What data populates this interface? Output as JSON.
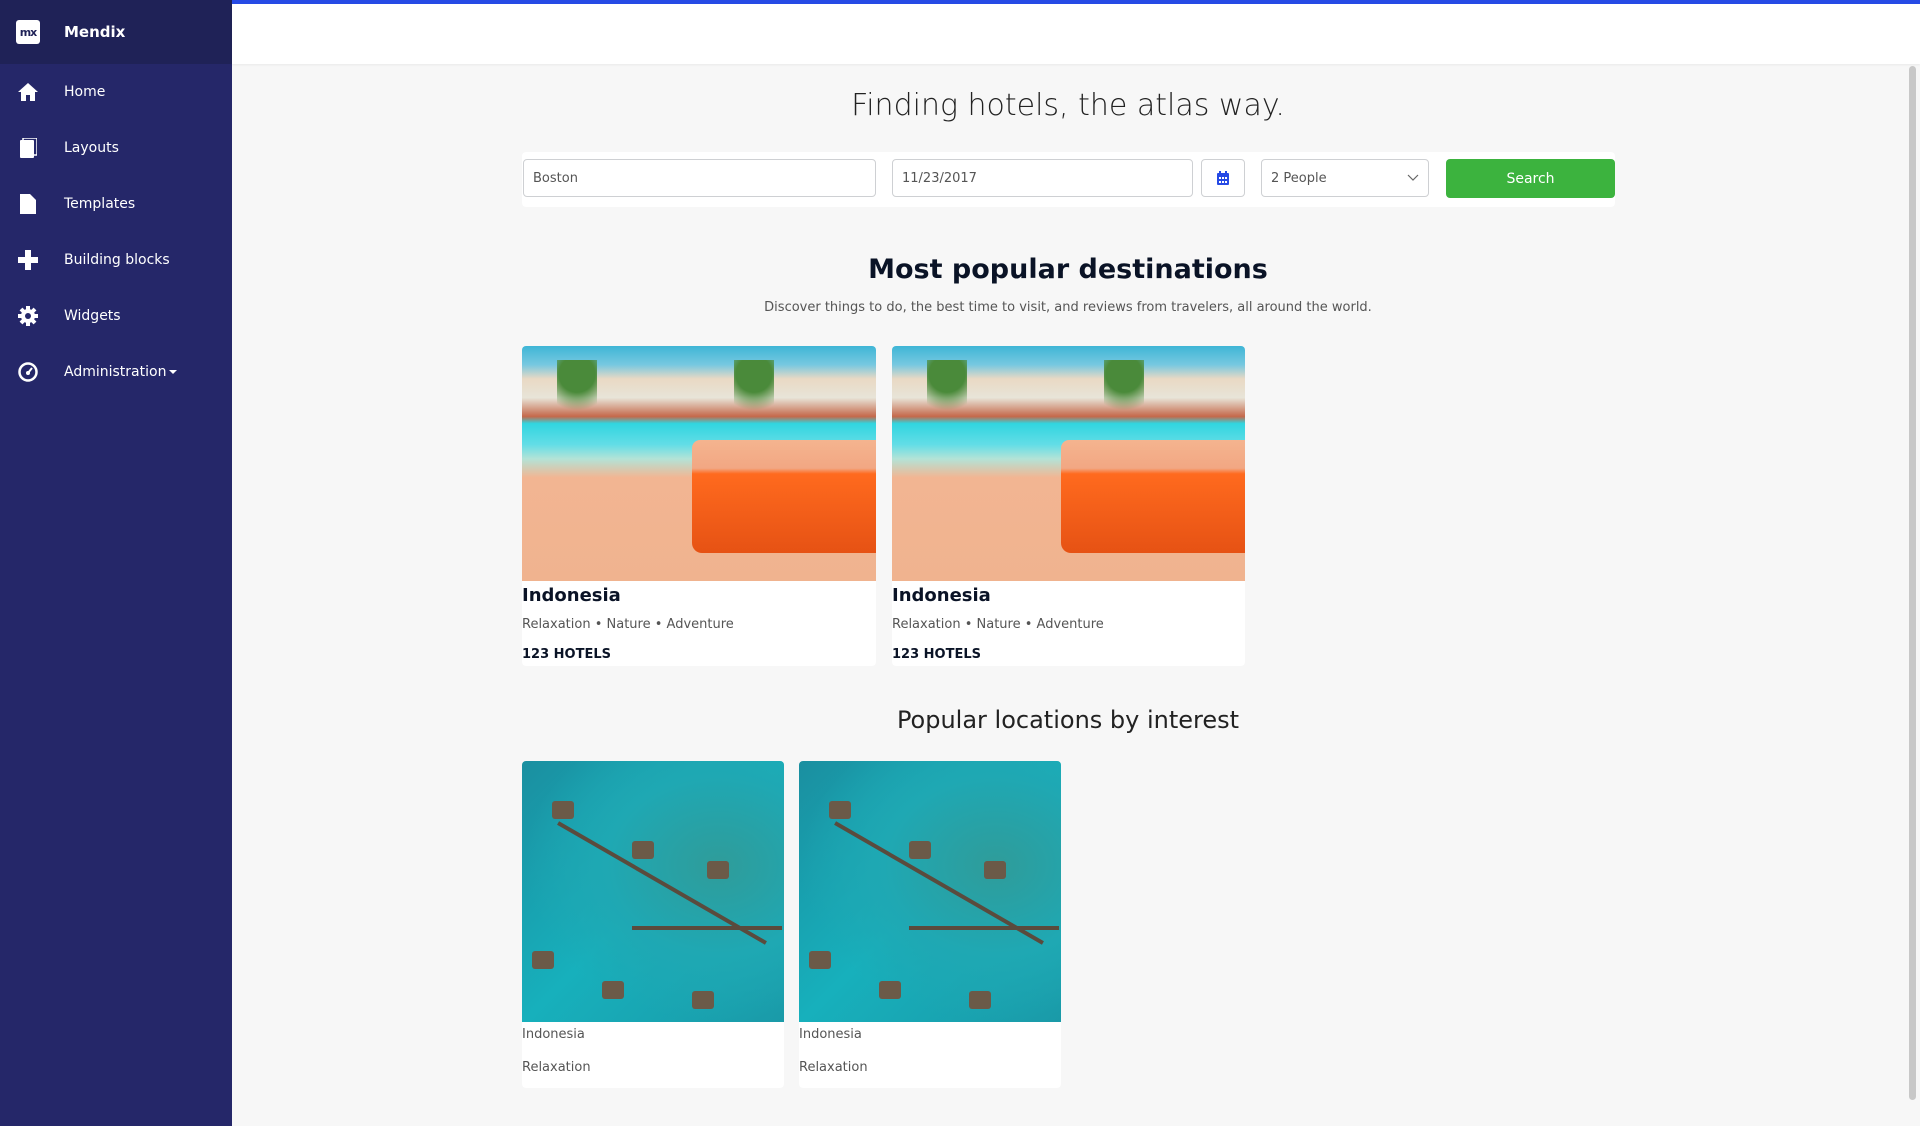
{
  "sidebar": {
    "brand": "Mendix",
    "logo": "mx",
    "items": [
      {
        "label": "Home",
        "icon": "home-icon"
      },
      {
        "label": "Layouts",
        "icon": "book-icon"
      },
      {
        "label": "Templates",
        "icon": "file-icon"
      },
      {
        "label": "Building blocks",
        "icon": "plus-icon"
      },
      {
        "label": "Widgets",
        "icon": "gear-icon"
      },
      {
        "label": "Administration",
        "icon": "dashboard-icon"
      }
    ]
  },
  "main": {
    "title": "Finding hotels, the atlas way.",
    "search": {
      "location": "Boston",
      "date": "11/23/2017",
      "people": "2 People",
      "button": "Search"
    },
    "popular": {
      "title": "Most popular destinations",
      "subtitle": "Discover things to do, the best time to visit, and reviews from travelers, all around the world.",
      "cards": [
        {
          "name": "Indonesia",
          "tags": "Relaxation • Nature • Adventure",
          "hotels": "123 HOTELS"
        },
        {
          "name": "Indonesia",
          "tags": "Relaxation • Nature • Adventure",
          "hotels": "123 HOTELS"
        }
      ]
    },
    "interest": {
      "title": "Popular locations by interest",
      "cards": [
        {
          "name": "Indonesia",
          "interest": "Relaxation"
        },
        {
          "name": "Indonesia",
          "interest": "Relaxation"
        }
      ]
    }
  },
  "colors": {
    "sidebar": "#252769",
    "accent": "#264ae5",
    "search": "#3cb33e"
  }
}
